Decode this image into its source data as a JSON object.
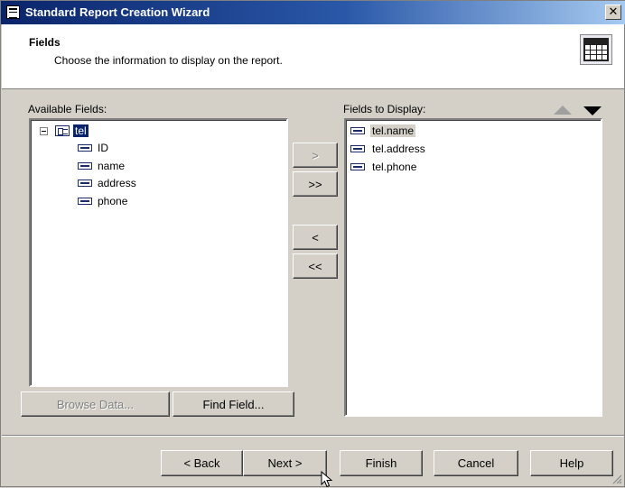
{
  "window": {
    "title": "Standard Report Creation Wizard",
    "close_glyph": "✕",
    "accent": "#0a246a"
  },
  "header": {
    "title": "Fields",
    "subtitle": "Choose the information to display on the report.",
    "icon": "table-grid-icon"
  },
  "available": {
    "label": "Available Fields:",
    "table": {
      "name": "tel",
      "expanded": true,
      "selected": true
    },
    "fields": [
      "ID",
      "name",
      "address",
      "phone"
    ]
  },
  "transfer": {
    "add_one": ">",
    "add_all": ">>",
    "remove_one": "<",
    "remove_all": "<<"
  },
  "display": {
    "label": "Fields to Display:",
    "items": [
      "tel.name",
      "tel.address",
      "tel.phone"
    ],
    "highlighted_index": 0,
    "move_up_icon": "triangle-up-icon",
    "move_down_icon": "triangle-down-icon"
  },
  "actions": {
    "browse_data": "Browse Data...",
    "find_field": "Find Field..."
  },
  "footer": {
    "back": "< Back",
    "next": "Next >",
    "finish": "Finish",
    "cancel": "Cancel",
    "help": "Help"
  }
}
